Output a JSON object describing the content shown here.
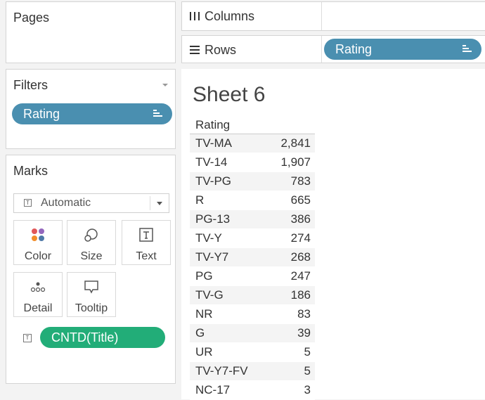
{
  "pages": {
    "title": "Pages"
  },
  "filters": {
    "title": "Filters",
    "pill": "Rating"
  },
  "marks": {
    "title": "Marks",
    "mark_type": "Automatic",
    "buttons": {
      "color": "Color",
      "size": "Size",
      "text": "Text",
      "detail": "Detail",
      "tooltip": "Tooltip"
    },
    "field": "CNTD(Title)"
  },
  "columns": {
    "label": "Columns"
  },
  "rows": {
    "label": "Rows",
    "pill": "Rating"
  },
  "sheet": {
    "title": "Sheet 6",
    "header": "Rating",
    "rows": [
      {
        "label": "TV-MA",
        "value": "2,841"
      },
      {
        "label": "TV-14",
        "value": "1,907"
      },
      {
        "label": "TV-PG",
        "value": "783"
      },
      {
        "label": "R",
        "value": "665"
      },
      {
        "label": "PG-13",
        "value": "386"
      },
      {
        "label": "TV-Y",
        "value": "274"
      },
      {
        "label": "TV-Y7",
        "value": "268"
      },
      {
        "label": "PG",
        "value": "247"
      },
      {
        "label": "TV-G",
        "value": "186"
      },
      {
        "label": "NR",
        "value": "83"
      },
      {
        "label": "G",
        "value": "39"
      },
      {
        "label": "UR",
        "value": "5"
      },
      {
        "label": "TV-Y7-FV",
        "value": "5"
      },
      {
        "label": "NC-17",
        "value": "3"
      }
    ]
  },
  "colors": {
    "dimension_pill": "#4a8fb0",
    "measure_pill": "#22ad78"
  }
}
